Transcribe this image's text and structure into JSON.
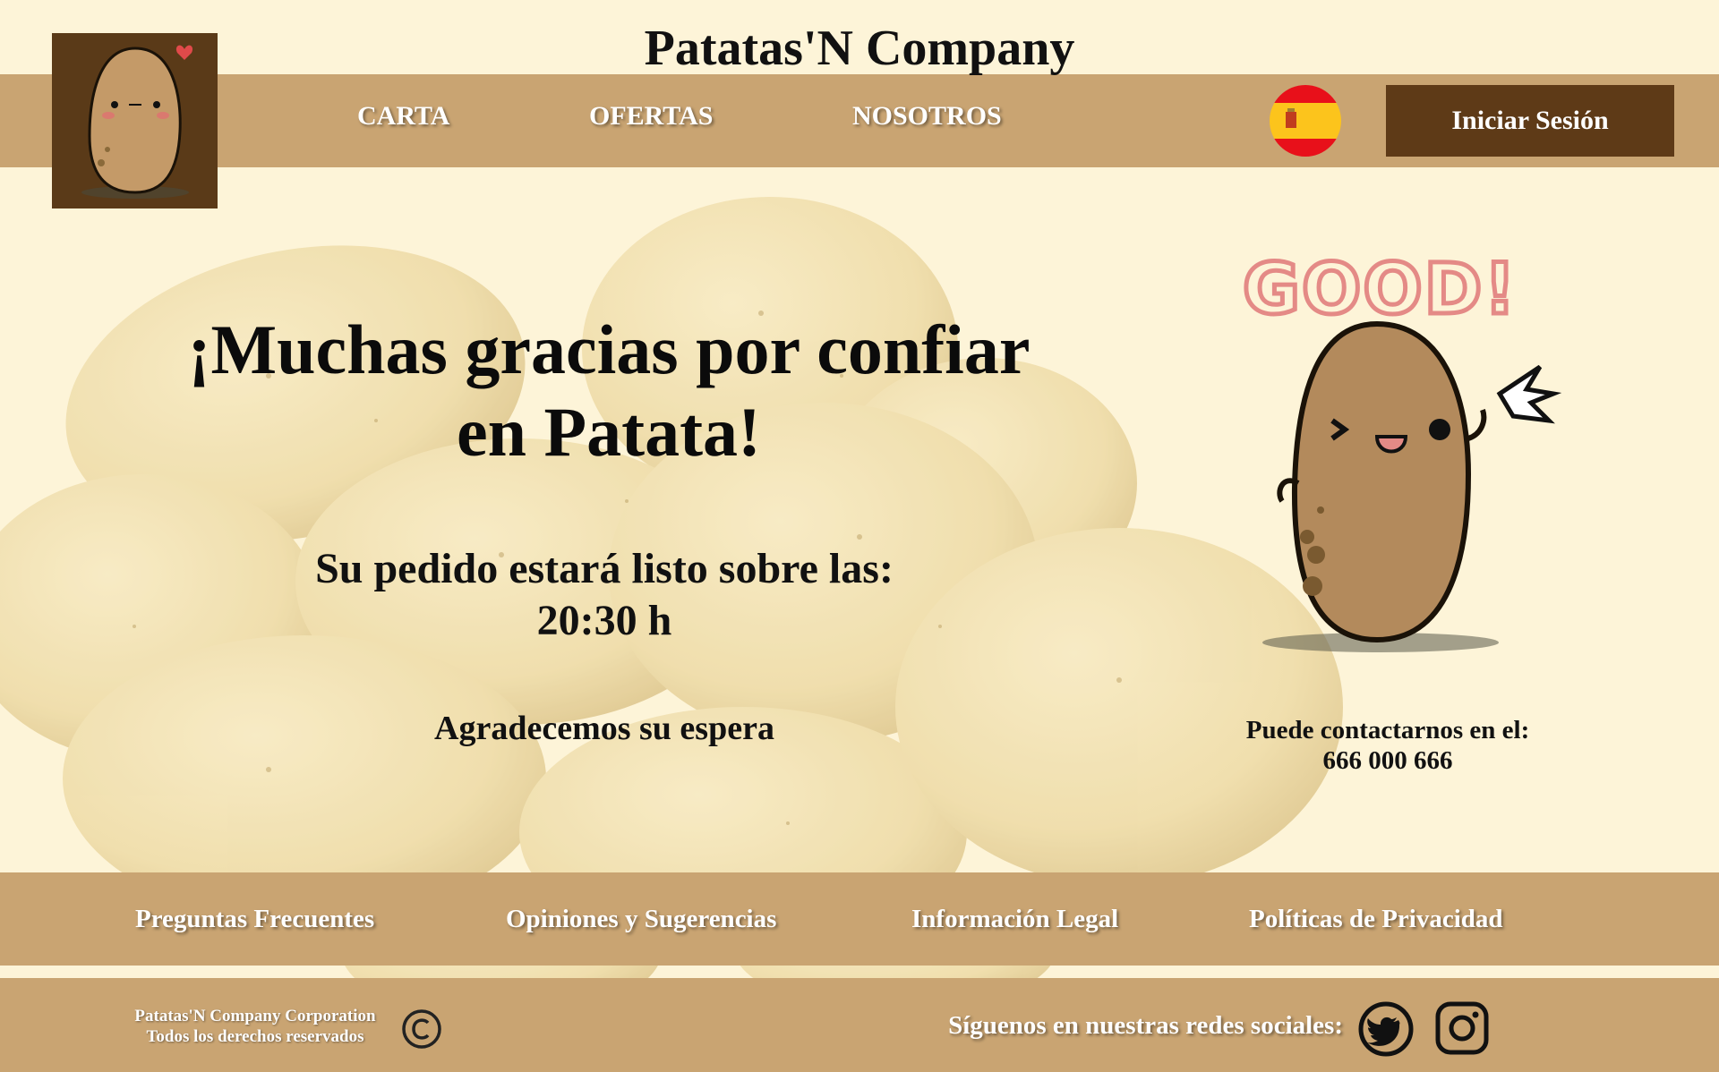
{
  "header": {
    "site_title": "Patatas'N Company",
    "nav": [
      "CARTA",
      "OFERTAS",
      "NOSOTROS"
    ],
    "language_flag": "spain-flag-icon",
    "login_label": "Iniciar Sesión"
  },
  "hero": {
    "title_line1": "¡Muchas gracias por confiar",
    "title_line2": "en Patata!",
    "ready_label": "Su pedido estará listo sobre las:",
    "ready_time": "20:30 h",
    "thanks": "Agradecemos su espera",
    "mascot_text": "GOOD!"
  },
  "contact": {
    "label": "Puede contactarnos en el:",
    "phone": "666 000 666"
  },
  "footer": {
    "links": [
      "Preguntas Frecuentes",
      "Opiniones y Sugerencias",
      "Información Legal",
      "Políticas de Privacidad"
    ],
    "company": "Patatas'N Company Corporation",
    "rights": "Todos los derechos reservados",
    "social_label": "Síguenos en nuestras redes sociales:",
    "social_icons": [
      "twitter-icon",
      "instagram-icon"
    ]
  },
  "colors": {
    "page_bg": "#fdf4d8",
    "bar": "#c9a472",
    "button": "#5e3a17",
    "logo_bg": "#5a3a18",
    "text": "#111111"
  }
}
